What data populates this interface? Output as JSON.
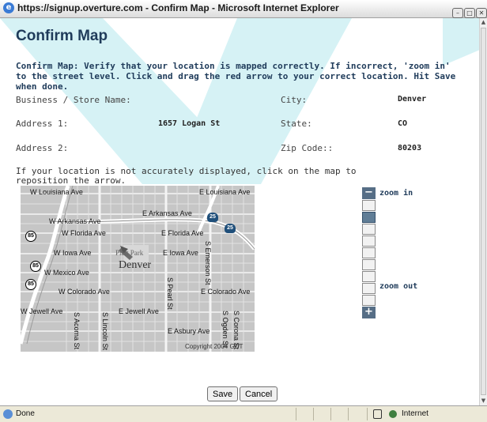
{
  "window": {
    "title": "https://signup.overture.com - Confirm Map - Microsoft Internet Explorer"
  },
  "page": {
    "heading": "Confirm Map",
    "instructions": "Confirm Map: Verify that your location is mapped correctly. If incorrect, 'zoom in' to the street level. Click and drag the red arrow to your correct location. Hit Save when done.",
    "reposition_text": "If your location is not accurately displayed, click on the map to reposition the arrow."
  },
  "fields": {
    "business_label": "Business / Store Name:",
    "business_value": "",
    "city_label": "City:",
    "city_value": "Denver",
    "address1_label": "Address 1:",
    "address1_value": "1657 Logan St",
    "state_label": "State:",
    "state_value": "CO",
    "address2_label": "Address 2:",
    "address2_value": "",
    "zip_label": "Zip Code::",
    "zip_value": "80203"
  },
  "map": {
    "streets": {
      "louisiana_w": "W Louisiana Ave",
      "louisiana_e": "E Louisiana Ave",
      "arkansas_w": "W Arkansas Ave",
      "arkansas_e": "E Arkansas Ave",
      "florida_w": "W Florida Ave",
      "florida_e": "E Florida Ave",
      "iowa_w": "W Iowa Ave",
      "iowa_e": "E Iowa Ave",
      "mexico_w": "W Mexico Ave",
      "colorado_w": "W Colorado Ave",
      "colorado_e": "E Colorado Ave",
      "jewell_w": "W Jewell Ave",
      "jewell_e": "E Jewell Ave",
      "asbury_e": "E Asbury Ave",
      "acoma": "S Acoma St",
      "lincoln": "S Lincoln St",
      "pearl": "S Pearl St",
      "emerson": "S Emerson St",
      "ogden": "S Ogden St",
      "corona": "S Corona St"
    },
    "park": "Platt Park",
    "city": "Denver",
    "shields": {
      "i25": "25",
      "us85": "85"
    },
    "copyright": "Copyright 2004 GDT"
  },
  "zoom": {
    "in_label": "zoom in",
    "out_label": "zoom out",
    "steps": 9,
    "selected_step": 1
  },
  "buttons": {
    "save": "Save",
    "cancel": "Cancel"
  },
  "status": {
    "text": "Done",
    "zone": "Internet"
  },
  "colors": {
    "heading": "#1f3b5a",
    "zoom_button": "#566e86",
    "swoosh": "#d6f2f5",
    "map_water": "#b5d2da"
  }
}
